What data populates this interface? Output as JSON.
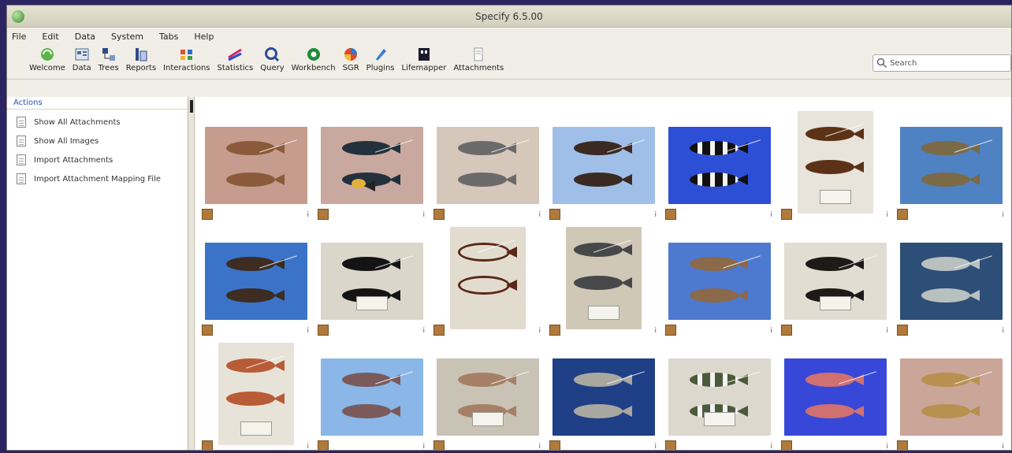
{
  "window": {
    "title": "Specify 6.5.00"
  },
  "menu": [
    "File",
    "Edit",
    "Data",
    "System",
    "Tabs",
    "Help"
  ],
  "toolbar": [
    {
      "label": "Welcome",
      "icon": "welcome-icon"
    },
    {
      "label": "Data",
      "icon": "data-icon"
    },
    {
      "label": "Trees",
      "icon": "trees-icon"
    },
    {
      "label": "Reports",
      "icon": "reports-icon"
    },
    {
      "label": "Interactions",
      "icon": "interactions-icon"
    },
    {
      "label": "Statistics",
      "icon": "statistics-icon"
    },
    {
      "label": "Query",
      "icon": "query-icon"
    },
    {
      "label": "Workbench",
      "icon": "workbench-icon"
    },
    {
      "label": "SGR",
      "icon": "sgr-icon"
    },
    {
      "label": "Plugins",
      "icon": "plugins-icon"
    },
    {
      "label": "Lifemapper",
      "icon": "lifemapper-icon"
    },
    {
      "label": "Attachments",
      "icon": "attachments-icon"
    }
  ],
  "search": {
    "value": "Search"
  },
  "sidebar": {
    "header": "Actions",
    "items": [
      "Show All Attachments",
      "Show All Images",
      "Import Attachments",
      "Import Attachment Mapping File"
    ]
  },
  "gallery": {
    "info_glyph": "i",
    "thumbs": [
      {
        "orient": "land",
        "bg": "#c59c8e",
        "fish": "#8a5a3a"
      },
      {
        "orient": "land",
        "bg": "#c9a8a0",
        "fish": "#23313d",
        "accent": "#e3b03a"
      },
      {
        "orient": "land",
        "bg": "#d6c7bb",
        "fish": "#6a6a6a"
      },
      {
        "orient": "land",
        "bg": "#9fbfe8",
        "fish": "#3a2a22"
      },
      {
        "orient": "land",
        "bg": "#2d4fd6",
        "fish": "#101010",
        "stripe": true
      },
      {
        "orient": "port",
        "bg": "#e8e4dc",
        "fish": "#5c3216",
        "tag": true
      },
      {
        "orient": "land",
        "bg": "#4f82c2",
        "fish": "#7a6a48"
      },
      {
        "orient": "land",
        "bg": "#3b73c8",
        "fish": "#3c2c22"
      },
      {
        "orient": "land",
        "bg": "#dad6c9",
        "fish": "#141414",
        "tag": true
      },
      {
        "orient": "port",
        "bg": "#e2dccf",
        "fish": "#5a2818",
        "eel": true
      },
      {
        "orient": "port",
        "bg": "#cfc8b6",
        "fish": "#47484a",
        "tag": true
      },
      {
        "orient": "land",
        "bg": "#4e79d0",
        "fish": "#8a6a4a"
      },
      {
        "orient": "land",
        "bg": "#e2ddd3",
        "fish": "#1e1a18",
        "tag": true
      },
      {
        "orient": "land",
        "bg": "#2d4e76",
        "fish": "#b8c0c0"
      },
      {
        "orient": "port",
        "bg": "#e8e3d8",
        "fish": "#b85c38",
        "tag": true
      },
      {
        "orient": "land",
        "bg": "#8ab7e8",
        "fish": "#7a5a5a"
      },
      {
        "orient": "land",
        "bg": "#c9c3b6",
        "fish": "#a58066",
        "tag": true
      },
      {
        "orient": "land",
        "bg": "#1f3f86",
        "fish": "#a8a8a0"
      },
      {
        "orient": "land",
        "bg": "#dcd8ce",
        "fish": "#4a5a3a",
        "tag": true,
        "stripe": true
      },
      {
        "orient": "land",
        "bg": "#3748d8",
        "fish": "#d07070"
      },
      {
        "orient": "land",
        "bg": "#c9a698",
        "fish": "#b89050"
      }
    ]
  }
}
